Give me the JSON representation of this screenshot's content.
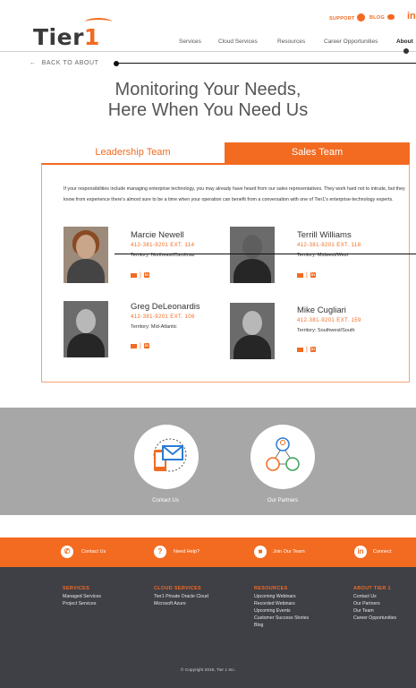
{
  "header": {
    "logo_text": "Tier",
    "logo_num": "1",
    "utility": {
      "support": "SUPPORT",
      "blog": "BLOG",
      "linkedin": "in"
    },
    "nav": [
      "Services",
      "Cloud Services",
      "Resources",
      "Career Opportunities",
      "About"
    ]
  },
  "back_link": "BACK TO ABOUT",
  "title": {
    "line1": "Monitoring Your Needs,",
    "line2": "Here When You Need Us"
  },
  "tabs": {
    "leadership": "Leadership Team",
    "sales": "Sales Team"
  },
  "intro": "If your responsibilities include managing enterprise technology, you may already have heard from our sales representatives. They work hard not to intrude, but they know from experience there's almost sure to be a time when your operation can benefit from a conversation with one of Tier1's enterprise-technology experts.",
  "people": [
    {
      "name": "Marcie Newell",
      "phone": "412-381-9201 EXT. 114",
      "territory": "Territory: Northeast/Carolinas"
    },
    {
      "name": "Terrill Williams",
      "phone": "412-381-9201 EXT. 118",
      "territory": "Territory: Midwest/West"
    },
    {
      "name": "Greg DeLeonardis",
      "phone": "412-381-9201 EXT. 106",
      "territory": "Territory: Mid-Atlantic"
    },
    {
      "name": "Mike Cugliari",
      "phone": "412-381-9201 EXT. 159",
      "territory": "Territory: Southwest/South"
    }
  ],
  "band": {
    "contact": "Contact Us",
    "partners": "Our Partners"
  },
  "orange_bar": {
    "contact": "Contact Us",
    "help": "Need Help?",
    "join": "Join Our Team",
    "connect": "Connect",
    "help_icon": "?",
    "connect_icon": "in"
  },
  "footer": {
    "services": {
      "head": "SERVICES",
      "items": [
        "Managed Services",
        "Project Services"
      ]
    },
    "cloud": {
      "head": "CLOUD SERVICES",
      "items": [
        "Tier1 Private Oracle Cloud",
        "Microsoft Azure"
      ]
    },
    "resources": {
      "head": "RESOURCES",
      "items": [
        "Upcoming Webinars",
        "Recorded Webinars",
        "Upcoming Events",
        "Customer Success Stories",
        "Blog"
      ]
    },
    "about": {
      "head": "ABOUT TIER 1",
      "items": [
        "Contact Us",
        "Our Partners",
        "Our Team",
        "Career Opportunities"
      ]
    },
    "copyright": "© Copyright 2018, Tier 1 Inc."
  },
  "colors": {
    "accent": "#f26b21",
    "band": "#a7a7a7",
    "footer": "#3f3f46"
  },
  "icons": [
    "gear-icon",
    "chat-icon",
    "linkedin-icon",
    "back-arrow-icon",
    "email-icon",
    "phone-icon",
    "help-icon",
    "briefcase-icon"
  ]
}
